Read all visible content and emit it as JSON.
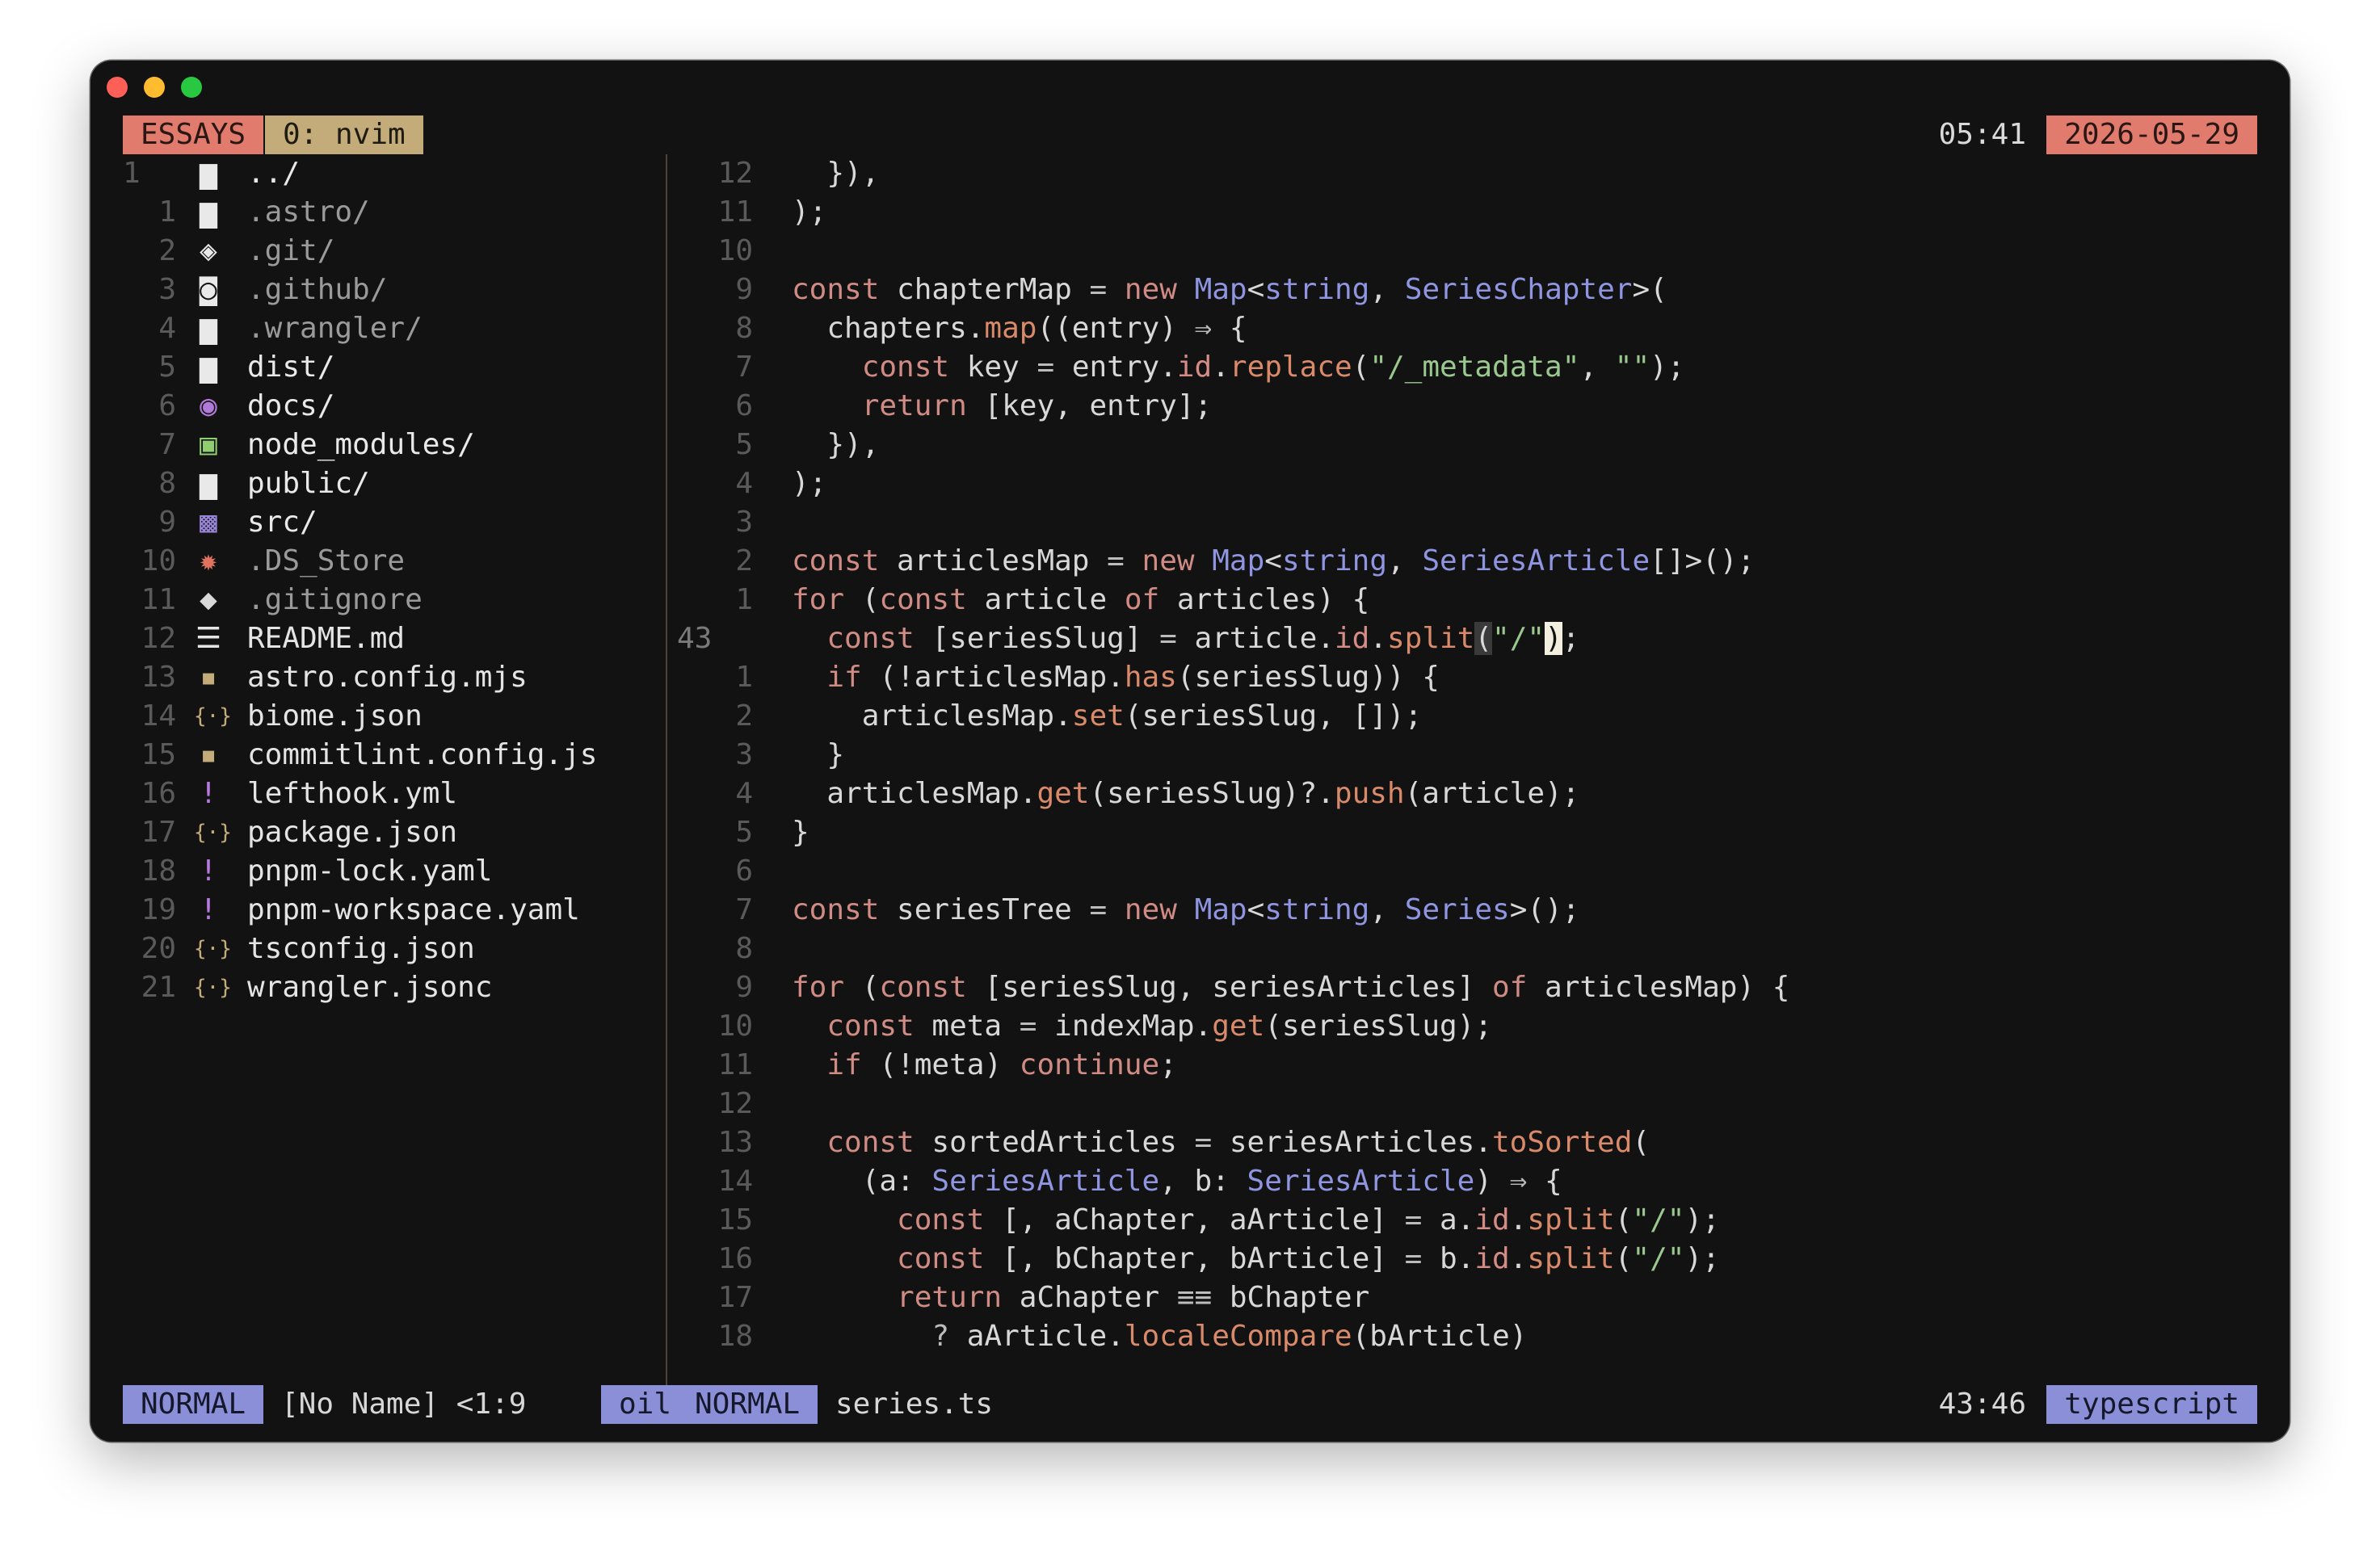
{
  "window": {
    "controls": [
      "close-dot",
      "minimize-dot",
      "zoom-dot"
    ],
    "colors": {
      "background": "#121212",
      "accent_tab": "#e07b6d",
      "window_tab": "#c4ac7a",
      "mode_badge": "#8a8fd8"
    }
  },
  "tmux": {
    "session": "ESSAYS",
    "window_tab": "0: nvim",
    "time": "05:41",
    "date": "2026-05-29"
  },
  "file_tree": {
    "entries": [
      {
        "num": "1",
        "icon": "folder-icon",
        "glyph": "▆",
        "color": "#e9e9e9",
        "name": "../",
        "kind": "dir"
      },
      {
        "num": "1",
        "icon": "folder-icon",
        "glyph": "▆",
        "color": "#e9e9e9",
        "name": ".astro/",
        "kind": "hid"
      },
      {
        "num": "2",
        "icon": "git-folder-icon",
        "glyph": "◈",
        "color": "#e9e9e9",
        "name": ".git/",
        "kind": "hid"
      },
      {
        "num": "3",
        "icon": "github-folder-icon",
        "glyph": "◙",
        "color": "#e9e9e9",
        "name": ".github/",
        "kind": "hid"
      },
      {
        "num": "4",
        "icon": "folder-icon",
        "glyph": "▆",
        "color": "#e9e9e9",
        "name": ".wrangler/",
        "kind": "hid"
      },
      {
        "num": "5",
        "icon": "folder-icon",
        "glyph": "▆",
        "color": "#e9e9e9",
        "name": "dist/",
        "kind": "dir"
      },
      {
        "num": "6",
        "icon": "docs-folder-icon",
        "glyph": "◉",
        "color": "#b27ad8",
        "name": "docs/",
        "kind": "dir"
      },
      {
        "num": "7",
        "icon": "node-modules-folder-icon",
        "glyph": "▣",
        "color": "#8fcf72",
        "name": "node_modules/",
        "kind": "dir"
      },
      {
        "num": "8",
        "icon": "folder-icon",
        "glyph": "▆",
        "color": "#e9e9e9",
        "name": "public/",
        "kind": "dir"
      },
      {
        "num": "9",
        "icon": "src-folder-icon",
        "glyph": "▩",
        "color": "#9a86d8",
        "name": "src/",
        "kind": "dir"
      },
      {
        "num": "10",
        "icon": "gear-icon",
        "glyph": "✹",
        "color": "#e0735f",
        "name": ".DS_Store",
        "kind": "hid"
      },
      {
        "num": "11",
        "icon": "git-icon",
        "glyph": "◆",
        "color": "#d8d8d8",
        "name": ".gitignore",
        "kind": "hid"
      },
      {
        "num": "12",
        "icon": "readme-icon",
        "glyph": "☰",
        "color": "#e4e4e4",
        "name": "README.md",
        "kind": "file"
      },
      {
        "num": "13",
        "icon": "javascript-icon",
        "glyph": "▪",
        "color": "#c4ac7a",
        "name": "astro.config.mjs",
        "kind": "file"
      },
      {
        "num": "14",
        "icon": "json-icon",
        "glyph": "{·}",
        "color": "#c4ac7a",
        "name": "biome.json",
        "kind": "file"
      },
      {
        "num": "15",
        "icon": "javascript-icon",
        "glyph": "▪",
        "color": "#c4ac7a",
        "name": "commitlint.config.js",
        "kind": "file"
      },
      {
        "num": "16",
        "icon": "yaml-icon",
        "glyph": "!",
        "color": "#b77ae0",
        "name": "lefthook.yml",
        "kind": "file"
      },
      {
        "num": "17",
        "icon": "json-icon",
        "glyph": "{·}",
        "color": "#c4ac7a",
        "name": "package.json",
        "kind": "file"
      },
      {
        "num": "18",
        "icon": "yaml-icon",
        "glyph": "!",
        "color": "#b77ae0",
        "name": "pnpm-lock.yaml",
        "kind": "file"
      },
      {
        "num": "19",
        "icon": "yaml-icon",
        "glyph": "!",
        "color": "#b77ae0",
        "name": "pnpm-workspace.yaml",
        "kind": "file"
      },
      {
        "num": "20",
        "icon": "json-icon",
        "glyph": "{·}",
        "color": "#c4ac7a",
        "name": "tsconfig.json",
        "kind": "file"
      },
      {
        "num": "21",
        "icon": "json-icon",
        "glyph": "{·}",
        "color": "#c4ac7a",
        "name": "wrangler.jsonc",
        "kind": "file"
      }
    ]
  },
  "editor": {
    "current_line": 43,
    "lines": [
      {
        "num": "12",
        "tokens": [
          [
            "  }),",
            "t"
          ]
        ]
      },
      {
        "num": "11",
        "tokens": [
          [
            ");",
            "t"
          ]
        ]
      },
      {
        "num": "10",
        "tokens": []
      },
      {
        "num": "9",
        "tokens": [
          [
            "const",
            "kw"
          ],
          [
            " chapterMap ",
            "t"
          ],
          [
            "=",
            "op"
          ],
          [
            " ",
            "t"
          ],
          [
            "new",
            "kw"
          ],
          [
            " ",
            "t"
          ],
          [
            "Map",
            "ty"
          ],
          [
            "<",
            "t"
          ],
          [
            "string",
            "ty"
          ],
          [
            ", ",
            "t"
          ],
          [
            "SeriesChapter",
            "ty"
          ],
          [
            ">(",
            "t"
          ]
        ]
      },
      {
        "num": "8",
        "tokens": [
          [
            "  chapters.",
            "t"
          ],
          [
            "map",
            "fn"
          ],
          [
            "((entry) ",
            "t"
          ],
          [
            "⇒",
            "op"
          ],
          [
            " {",
            "t"
          ]
        ]
      },
      {
        "num": "7",
        "tokens": [
          [
            "    ",
            "t"
          ],
          [
            "const",
            "kw"
          ],
          [
            " key ",
            "t"
          ],
          [
            "=",
            "op"
          ],
          [
            " entry.",
            "t"
          ],
          [
            "id",
            "pr"
          ],
          [
            ".",
            "t"
          ],
          [
            "replace",
            "fn"
          ],
          [
            "(",
            "t"
          ],
          [
            "\"/_metadata\"",
            "st"
          ],
          [
            ", ",
            "t"
          ],
          [
            "\"\"",
            "st"
          ],
          [
            ");",
            "t"
          ]
        ]
      },
      {
        "num": "6",
        "tokens": [
          [
            "    ",
            "t"
          ],
          [
            "return",
            "kw"
          ],
          [
            " [key, entry];",
            "t"
          ]
        ]
      },
      {
        "num": "5",
        "tokens": [
          [
            "  }),",
            "t"
          ]
        ]
      },
      {
        "num": "4",
        "tokens": [
          [
            ");",
            "t"
          ]
        ]
      },
      {
        "num": "3",
        "tokens": []
      },
      {
        "num": "2",
        "tokens": [
          [
            "const",
            "kw"
          ],
          [
            " articlesMap ",
            "t"
          ],
          [
            "=",
            "op"
          ],
          [
            " ",
            "t"
          ],
          [
            "new",
            "kw"
          ],
          [
            " ",
            "t"
          ],
          [
            "Map",
            "ty"
          ],
          [
            "<",
            "t"
          ],
          [
            "string",
            "ty"
          ],
          [
            ", ",
            "t"
          ],
          [
            "SeriesArticle",
            "ty"
          ],
          [
            "[]>();",
            "t"
          ]
        ]
      },
      {
        "num": "1",
        "tokens": [
          [
            "for",
            "kw"
          ],
          [
            " (",
            "t"
          ],
          [
            "const",
            "kw"
          ],
          [
            " article ",
            "t"
          ],
          [
            "of",
            "kw"
          ],
          [
            " articles) {",
            "t"
          ]
        ]
      },
      {
        "num": "43",
        "current": true,
        "tokens": [
          [
            "  ",
            "t"
          ],
          [
            "const",
            "kw"
          ],
          [
            " [seriesSlug] ",
            "t"
          ],
          [
            "=",
            "op"
          ],
          [
            " article.",
            "t"
          ],
          [
            "id",
            "pr"
          ],
          [
            ".",
            "t"
          ],
          [
            "split",
            "fn"
          ],
          [
            "(",
            "hl"
          ],
          [
            "\"/\"",
            "st"
          ],
          [
            ")",
            "cursor"
          ],
          [
            ";",
            "t"
          ]
        ]
      },
      {
        "num": "1",
        "tokens": [
          [
            "  ",
            "t"
          ],
          [
            "if",
            "kw"
          ],
          [
            " (!articlesMap.",
            "t"
          ],
          [
            "has",
            "fn"
          ],
          [
            "(seriesSlug)) {",
            "t"
          ]
        ]
      },
      {
        "num": "2",
        "tokens": [
          [
            "    articlesMap.",
            "t"
          ],
          [
            "set",
            "fn"
          ],
          [
            "(seriesSlug, []);",
            "t"
          ]
        ]
      },
      {
        "num": "3",
        "tokens": [
          [
            "  }",
            "t"
          ]
        ]
      },
      {
        "num": "4",
        "tokens": [
          [
            "  articlesMap.",
            "t"
          ],
          [
            "get",
            "fn"
          ],
          [
            "(seriesSlug)?.",
            "t"
          ],
          [
            "push",
            "fn"
          ],
          [
            "(article);",
            "t"
          ]
        ]
      },
      {
        "num": "5",
        "tokens": [
          [
            "}",
            "t"
          ]
        ]
      },
      {
        "num": "6",
        "tokens": []
      },
      {
        "num": "7",
        "tokens": [
          [
            "const",
            "kw"
          ],
          [
            " seriesTree ",
            "t"
          ],
          [
            "=",
            "op"
          ],
          [
            " ",
            "t"
          ],
          [
            "new",
            "kw"
          ],
          [
            " ",
            "t"
          ],
          [
            "Map",
            "ty"
          ],
          [
            "<",
            "t"
          ],
          [
            "string",
            "ty"
          ],
          [
            ", ",
            "t"
          ],
          [
            "Series",
            "ty"
          ],
          [
            ">();",
            "t"
          ]
        ]
      },
      {
        "num": "8",
        "tokens": []
      },
      {
        "num": "9",
        "tokens": [
          [
            "for",
            "kw"
          ],
          [
            " (",
            "t"
          ],
          [
            "const",
            "kw"
          ],
          [
            " [seriesSlug, seriesArticles] ",
            "t"
          ],
          [
            "of",
            "kw"
          ],
          [
            " articlesMap) {",
            "t"
          ]
        ]
      },
      {
        "num": "10",
        "tokens": [
          [
            "  ",
            "t"
          ],
          [
            "const",
            "kw"
          ],
          [
            " meta ",
            "t"
          ],
          [
            "=",
            "op"
          ],
          [
            " indexMap.",
            "t"
          ],
          [
            "get",
            "fn"
          ],
          [
            "(seriesSlug);",
            "t"
          ]
        ]
      },
      {
        "num": "11",
        "tokens": [
          [
            "  ",
            "t"
          ],
          [
            "if",
            "kw"
          ],
          [
            " (!meta) ",
            "t"
          ],
          [
            "continue",
            "kw"
          ],
          [
            ";",
            "t"
          ]
        ]
      },
      {
        "num": "12",
        "tokens": []
      },
      {
        "num": "13",
        "tokens": [
          [
            "  ",
            "t"
          ],
          [
            "const",
            "kw"
          ],
          [
            " sortedArticles ",
            "t"
          ],
          [
            "=",
            "op"
          ],
          [
            " seriesArticles.",
            "t"
          ],
          [
            "toSorted",
            "fn"
          ],
          [
            "(",
            "t"
          ]
        ]
      },
      {
        "num": "14",
        "tokens": [
          [
            "    (a: ",
            "t"
          ],
          [
            "SeriesArticle",
            "ty"
          ],
          [
            ", b: ",
            "t"
          ],
          [
            "SeriesArticle",
            "ty"
          ],
          [
            ") ",
            "t"
          ],
          [
            "⇒",
            "op"
          ],
          [
            " {",
            "t"
          ]
        ]
      },
      {
        "num": "15",
        "tokens": [
          [
            "      ",
            "t"
          ],
          [
            "const",
            "kw"
          ],
          [
            " [, aChapter, aArticle] ",
            "t"
          ],
          [
            "=",
            "op"
          ],
          [
            " a.",
            "t"
          ],
          [
            "id",
            "pr"
          ],
          [
            ".",
            "t"
          ],
          [
            "split",
            "fn"
          ],
          [
            "(",
            "t"
          ],
          [
            "\"/\"",
            "st"
          ],
          [
            ");",
            "t"
          ]
        ]
      },
      {
        "num": "16",
        "tokens": [
          [
            "      ",
            "t"
          ],
          [
            "const",
            "kw"
          ],
          [
            " [, bChapter, bArticle] ",
            "t"
          ],
          [
            "=",
            "op"
          ],
          [
            " b.",
            "t"
          ],
          [
            "id",
            "pr"
          ],
          [
            ".",
            "t"
          ],
          [
            "split",
            "fn"
          ],
          [
            "(",
            "t"
          ],
          [
            "\"/\"",
            "st"
          ],
          [
            ");",
            "t"
          ]
        ]
      },
      {
        "num": "17",
        "tokens": [
          [
            "      ",
            "t"
          ],
          [
            "return",
            "kw"
          ],
          [
            " aChapter ",
            "t"
          ],
          [
            "≡≡",
            "op"
          ],
          [
            " bChapter",
            "t"
          ]
        ]
      },
      {
        "num": "18",
        "tokens": [
          [
            "        ",
            "t"
          ],
          [
            "?",
            "op"
          ],
          [
            " aArticle.",
            "t"
          ],
          [
            "localeCompare",
            "fn"
          ],
          [
            "(bArticle)",
            "t"
          ]
        ]
      }
    ]
  },
  "statusline_left": {
    "mode": "NORMAL",
    "buffer": "[No Name] <1:9",
    "filetype": "oil"
  },
  "statusline_right": {
    "mode": "NORMAL",
    "filename": "series.ts",
    "position": "43:46",
    "filetype": "typescript"
  }
}
